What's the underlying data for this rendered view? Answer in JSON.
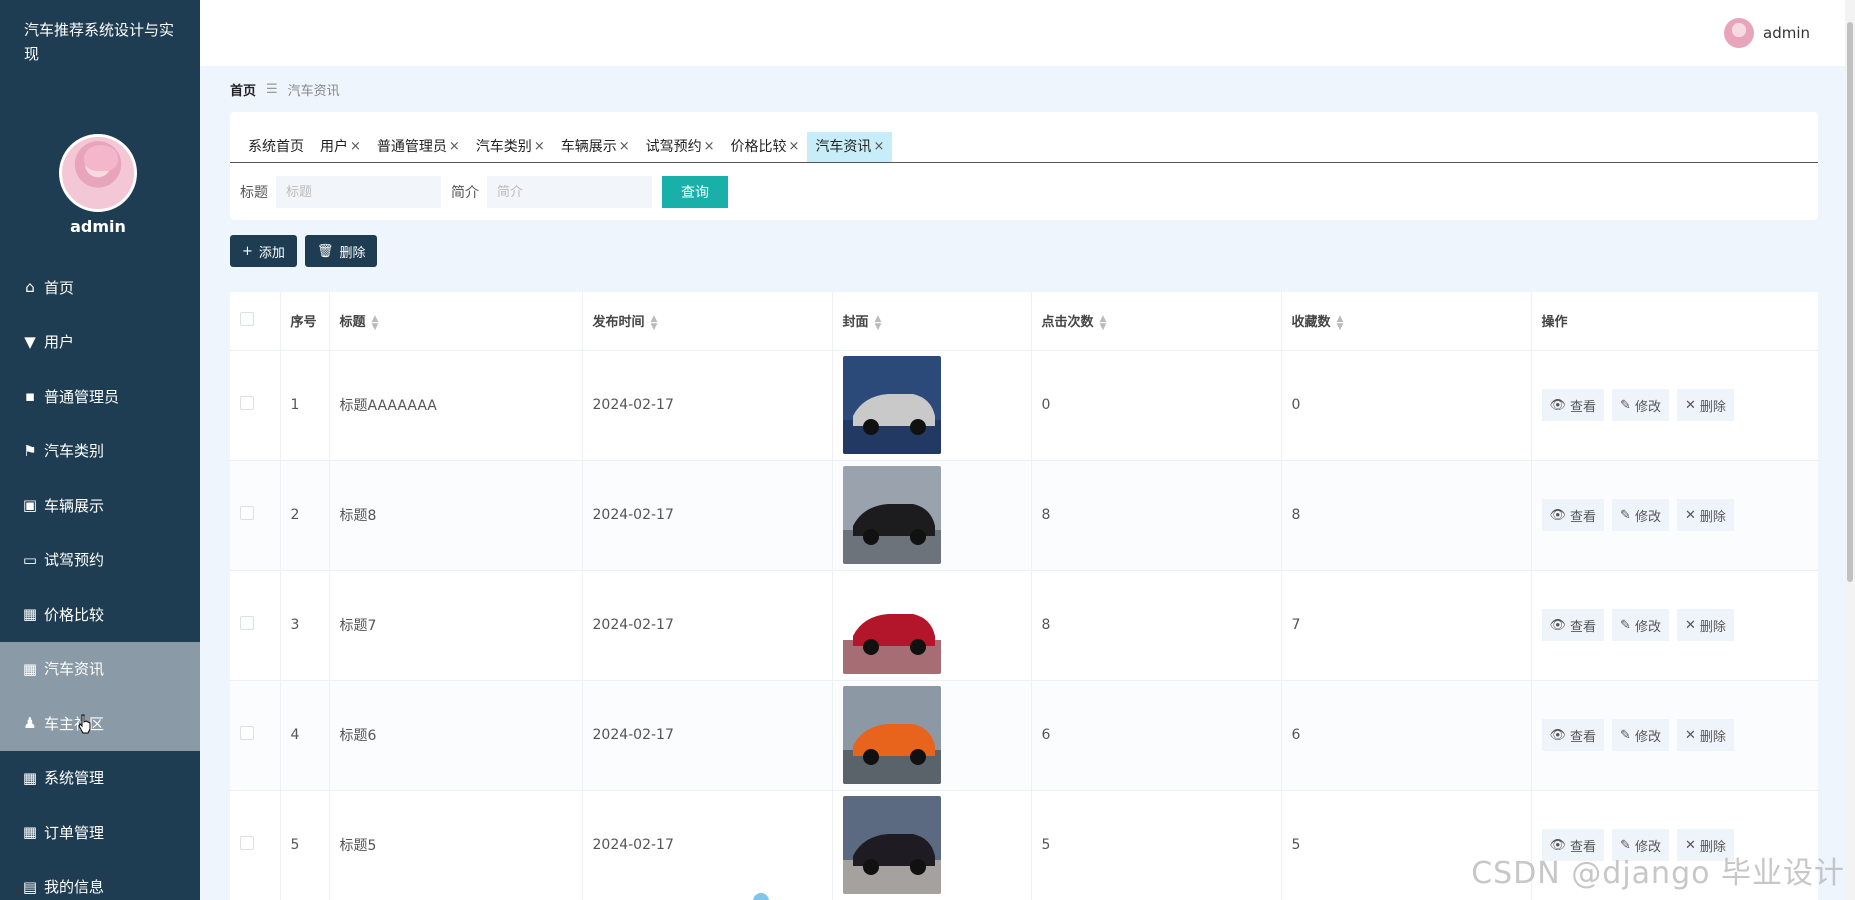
{
  "app": {
    "title": "汽车推荐系统设计与实现"
  },
  "sidebar": {
    "username": "admin",
    "items": [
      {
        "label": "首页",
        "icon": "home-icon",
        "glyph": "⌂"
      },
      {
        "label": "用户",
        "icon": "pin-icon",
        "glyph": "▼"
      },
      {
        "label": "普通管理员",
        "icon": "chat-icon",
        "glyph": "▪"
      },
      {
        "label": "汽车类别",
        "icon": "flag-icon",
        "glyph": "⚑"
      },
      {
        "label": "车辆展示",
        "icon": "clipboard-icon",
        "glyph": "▣"
      },
      {
        "label": "试驾预约",
        "icon": "monitor-icon",
        "glyph": "▭"
      },
      {
        "label": "价格比较",
        "icon": "grid-icon",
        "glyph": "▦"
      },
      {
        "label": "汽车资讯",
        "icon": "grid-icon",
        "glyph": "▦"
      },
      {
        "label": "车主社区",
        "icon": "user-icon",
        "glyph": "♟"
      },
      {
        "label": "系统管理",
        "icon": "grid-icon",
        "glyph": "▦"
      },
      {
        "label": "订单管理",
        "icon": "grid9-icon",
        "glyph": "▦"
      },
      {
        "label": "我的信息",
        "icon": "card-icon",
        "glyph": "▤"
      }
    ],
    "active_index": 7,
    "hover_index": 8
  },
  "topbar": {
    "username": "admin"
  },
  "breadcrumb": {
    "home": "首页",
    "separator": "☰",
    "current": "汽车资讯"
  },
  "tabs": [
    {
      "label": "系统首页",
      "closable": false
    },
    {
      "label": "用户",
      "closable": true
    },
    {
      "label": "普通管理员",
      "closable": true
    },
    {
      "label": "汽车类别",
      "closable": true
    },
    {
      "label": "车辆展示",
      "closable": true
    },
    {
      "label": "试驾预约",
      "closable": true
    },
    {
      "label": "价格比较",
      "closable": true
    },
    {
      "label": "汽车资讯",
      "closable": true,
      "active": true
    }
  ],
  "search": {
    "title_label": "标题",
    "title_placeholder": "标题",
    "title_value": "",
    "intro_label": "简介",
    "intro_placeholder": "简介",
    "intro_value": "",
    "query_label": "查询"
  },
  "actions": {
    "add_label": "添加",
    "delete_label": "删除"
  },
  "table": {
    "columns": [
      "序号",
      "标题",
      "发布时间",
      "封面",
      "点击次数",
      "收藏数",
      "操作"
    ],
    "rows": [
      {
        "index": "1",
        "title": "标题AAAAAAA",
        "date": "2024-02-17",
        "cover": "engine-bay-photo",
        "clicks": "0",
        "favorites": "0"
      },
      {
        "index": "2",
        "title": "标题8",
        "date": "2024-02-17",
        "cover": "black-minivan-photo",
        "clicks": "8",
        "favorites": "8"
      },
      {
        "index": "3",
        "title": "标题7",
        "date": "2024-02-17",
        "cover": "red-sedan-photo",
        "clicks": "8",
        "favorites": "7"
      },
      {
        "index": "4",
        "title": "标题6",
        "date": "2024-02-17",
        "cover": "orange-sports-car-photo",
        "clicks": "6",
        "favorites": "6"
      },
      {
        "index": "5",
        "title": "标题5",
        "date": "2024-02-17",
        "cover": "dark-suv-photo",
        "clicks": "5",
        "favorites": "5"
      }
    ],
    "ops": {
      "view": "查看",
      "edit": "修改",
      "delete": "删除"
    }
  },
  "watermark": "CSDN @django 毕业设计",
  "colors": {
    "sidebar": "#1f3d52",
    "accent": "#18b0a8",
    "active_tab": "#c7eef8"
  }
}
